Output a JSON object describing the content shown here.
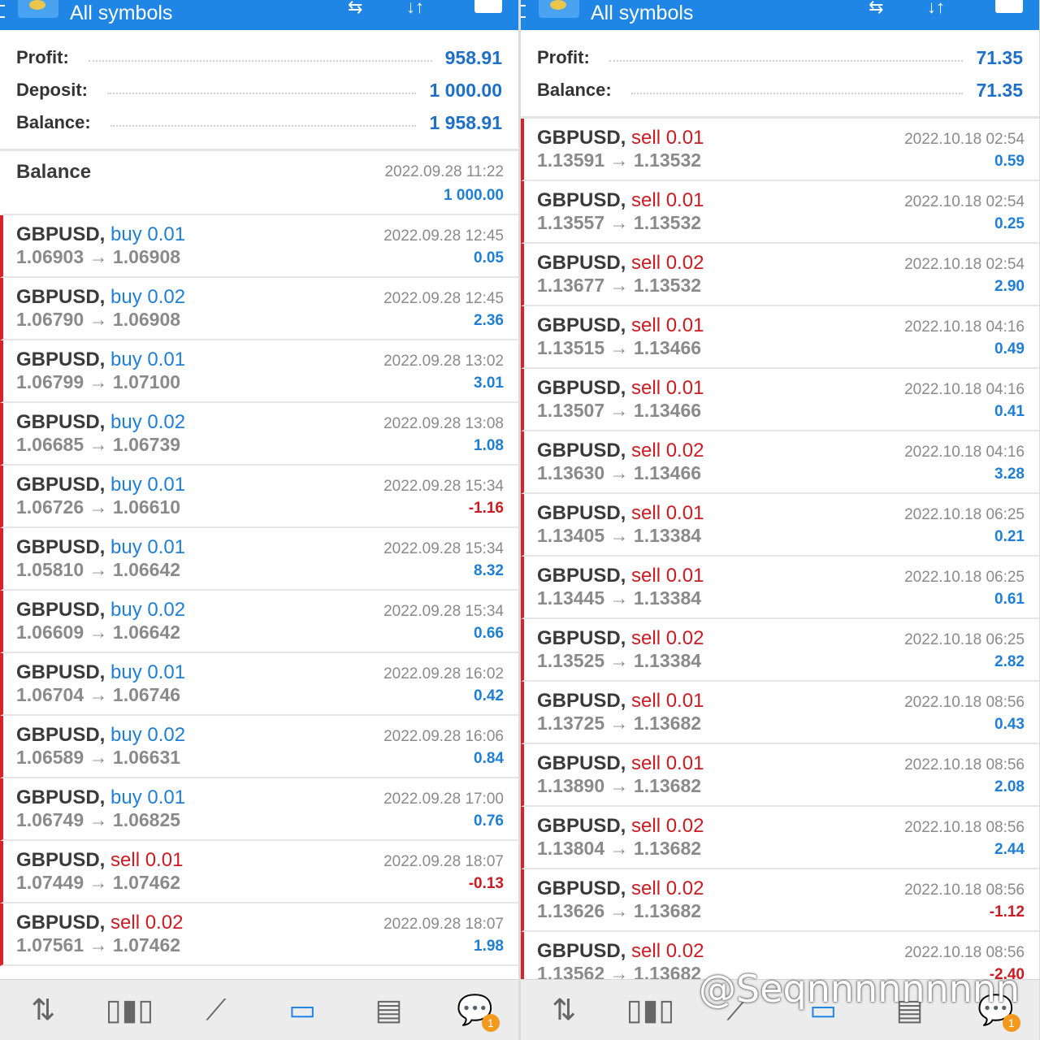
{
  "left": {
    "title": "All symbols",
    "summary": [
      {
        "label": "Profit:",
        "value": "958.91"
      },
      {
        "label": "Deposit:",
        "value": "1 000.00"
      },
      {
        "label": "Balance:",
        "value": "1 958.91"
      }
    ],
    "balance_entry": {
      "label": "Balance",
      "time": "2022.09.28 11:22",
      "amount": "1 000.00"
    },
    "deals": [
      {
        "symbol": "GBPUSD,",
        "type": "buy 0.01",
        "prices": "1.06903 → 1.06908",
        "time": "2022.09.28 12:45",
        "profit": "0.05"
      },
      {
        "symbol": "GBPUSD,",
        "type": "buy 0.02",
        "prices": "1.06790 → 1.06908",
        "time": "2022.09.28 12:45",
        "profit": "2.36"
      },
      {
        "symbol": "GBPUSD,",
        "type": "buy 0.01",
        "prices": "1.06799 → 1.07100",
        "time": "2022.09.28 13:02",
        "profit": "3.01"
      },
      {
        "symbol": "GBPUSD,",
        "type": "buy 0.02",
        "prices": "1.06685 → 1.06739",
        "time": "2022.09.28 13:08",
        "profit": "1.08"
      },
      {
        "symbol": "GBPUSD,",
        "type": "buy 0.01",
        "prices": "1.06726 → 1.06610",
        "time": "2022.09.28 15:34",
        "profit": "-1.16"
      },
      {
        "symbol": "GBPUSD,",
        "type": "buy 0.01",
        "prices": "1.05810 → 1.06642",
        "time": "2022.09.28 15:34",
        "profit": "8.32"
      },
      {
        "symbol": "GBPUSD,",
        "type": "buy 0.02",
        "prices": "1.06609 → 1.06642",
        "time": "2022.09.28 15:34",
        "profit": "0.66"
      },
      {
        "symbol": "GBPUSD,",
        "type": "buy 0.01",
        "prices": "1.06704 → 1.06746",
        "time": "2022.09.28 16:02",
        "profit": "0.42"
      },
      {
        "symbol": "GBPUSD,",
        "type": "buy 0.02",
        "prices": "1.06589 → 1.06631",
        "time": "2022.09.28 16:06",
        "profit": "0.84"
      },
      {
        "symbol": "GBPUSD,",
        "type": "buy 0.01",
        "prices": "1.06749 → 1.06825",
        "time": "2022.09.28 17:00",
        "profit": "0.76"
      },
      {
        "symbol": "GBPUSD,",
        "type": "sell 0.01",
        "prices": "1.07449 → 1.07462",
        "time": "2022.09.28 18:07",
        "profit": "-0.13"
      },
      {
        "symbol": "GBPUSD,",
        "type": "sell 0.02",
        "prices": "1.07561 → 1.07462",
        "time": "2022.09.28 18:07",
        "profit": "1.98"
      }
    ],
    "badge": "1"
  },
  "right": {
    "title": "All symbols",
    "summary": [
      {
        "label": "Profit:",
        "value": "71.35"
      },
      {
        "label": "Balance:",
        "value": "71.35"
      }
    ],
    "deals": [
      {
        "symbol": "GBPUSD,",
        "type": "sell 0.01",
        "prices": "1.13591 → 1.13532",
        "time": "2022.10.18 02:54",
        "profit": "0.59"
      },
      {
        "symbol": "GBPUSD,",
        "type": "sell 0.01",
        "prices": "1.13557 → 1.13532",
        "time": "2022.10.18 02:54",
        "profit": "0.25"
      },
      {
        "symbol": "GBPUSD,",
        "type": "sell 0.02",
        "prices": "1.13677 → 1.13532",
        "time": "2022.10.18 02:54",
        "profit": "2.90"
      },
      {
        "symbol": "GBPUSD,",
        "type": "sell 0.01",
        "prices": "1.13515 → 1.13466",
        "time": "2022.10.18 04:16",
        "profit": "0.49"
      },
      {
        "symbol": "GBPUSD,",
        "type": "sell 0.01",
        "prices": "1.13507 → 1.13466",
        "time": "2022.10.18 04:16",
        "profit": "0.41"
      },
      {
        "symbol": "GBPUSD,",
        "type": "sell 0.02",
        "prices": "1.13630 → 1.13466",
        "time": "2022.10.18 04:16",
        "profit": "3.28"
      },
      {
        "symbol": "GBPUSD,",
        "type": "sell 0.01",
        "prices": "1.13405 → 1.13384",
        "time": "2022.10.18 06:25",
        "profit": "0.21"
      },
      {
        "symbol": "GBPUSD,",
        "type": "sell 0.01",
        "prices": "1.13445 → 1.13384",
        "time": "2022.10.18 06:25",
        "profit": "0.61"
      },
      {
        "symbol": "GBPUSD,",
        "type": "sell 0.02",
        "prices": "1.13525 → 1.13384",
        "time": "2022.10.18 06:25",
        "profit": "2.82"
      },
      {
        "symbol": "GBPUSD,",
        "type": "sell 0.01",
        "prices": "1.13725 → 1.13682",
        "time": "2022.10.18 08:56",
        "profit": "0.43"
      },
      {
        "symbol": "GBPUSD,",
        "type": "sell 0.01",
        "prices": "1.13890 → 1.13682",
        "time": "2022.10.18 08:56",
        "profit": "2.08"
      },
      {
        "symbol": "GBPUSD,",
        "type": "sell 0.02",
        "prices": "1.13804 → 1.13682",
        "time": "2022.10.18 08:56",
        "profit": "2.44"
      },
      {
        "symbol": "GBPUSD,",
        "type": "sell 0.02",
        "prices": "1.13626 → 1.13682",
        "time": "2022.10.18 08:56",
        "profit": "-1.12"
      },
      {
        "symbol": "GBPUSD,",
        "type": "sell 0.02",
        "prices": "1.13562 → 1.13682",
        "time": "2022.10.18 08:56",
        "profit": "-2.40"
      }
    ],
    "badge": "1"
  },
  "bottom_nav": [
    "quotes-icon",
    "chart-icon",
    "trade-icon",
    "history-icon",
    "news-icon",
    "messages-icon"
  ],
  "watermark": "@Seqnnnnnnnnn",
  "colors": {
    "accent": "#1f86e6",
    "buy": "#1f7fd6",
    "sell": "#cc1c22",
    "border": "#d9232a"
  }
}
